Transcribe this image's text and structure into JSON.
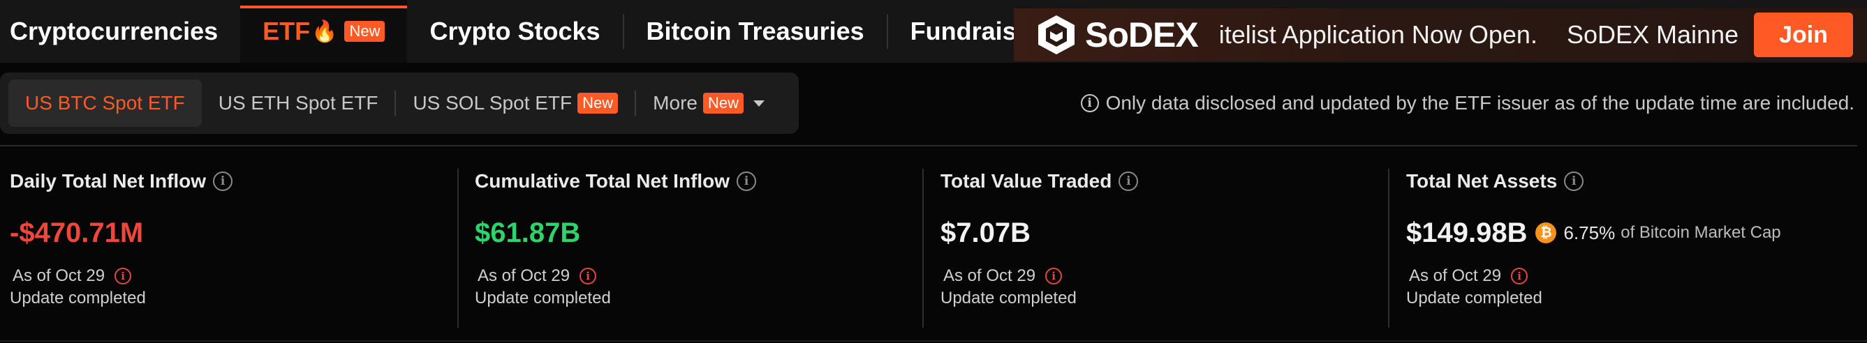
{
  "nav": {
    "tabs": [
      {
        "label": "Cryptocurrencies"
      },
      {
        "label": "ETF",
        "icon": "flame-icon",
        "badge": "New"
      },
      {
        "label": "Crypto Stocks"
      },
      {
        "label": "Bitcoin Treasuries"
      },
      {
        "label": "Fundraising"
      }
    ]
  },
  "banner": {
    "logo_text": "SoDEX",
    "text1": "itelist Application Now Open.",
    "text2": "SoDEX Mainne",
    "cta": "Join"
  },
  "subtabs": {
    "items": [
      {
        "label": "US BTC Spot ETF"
      },
      {
        "label": "US ETH Spot ETF"
      },
      {
        "label": "US SOL Spot ETF",
        "badge": "New"
      },
      {
        "label": "More",
        "badge": "New"
      }
    ]
  },
  "disclaimer": "Only data disclosed and updated by the ETF issuer as of the update time are included.",
  "stats": [
    {
      "label": "Daily Total Net Inflow",
      "value": "-$470.71M",
      "as_of": "As of Oct 29",
      "status": "Update completed"
    },
    {
      "label": "Cumulative Total Net Inflow",
      "value": "$61.87B",
      "as_of": "As of Oct 29",
      "status": "Update completed"
    },
    {
      "label": "Total Value Traded",
      "value": "$7.07B",
      "as_of": "As of Oct 29",
      "status": "Update completed"
    },
    {
      "label": "Total Net Assets",
      "value": "$149.98B",
      "btc_pct": "6.75%",
      "btc_pct_suffix": "of Bitcoin Market Cap",
      "as_of": "As of Oct 29",
      "status": "Update completed"
    }
  ],
  "colors": {
    "accent": "#ff5a25",
    "negative": "#f0463c",
    "positive": "#2fd26b",
    "bitcoin": "#f7931a"
  }
}
